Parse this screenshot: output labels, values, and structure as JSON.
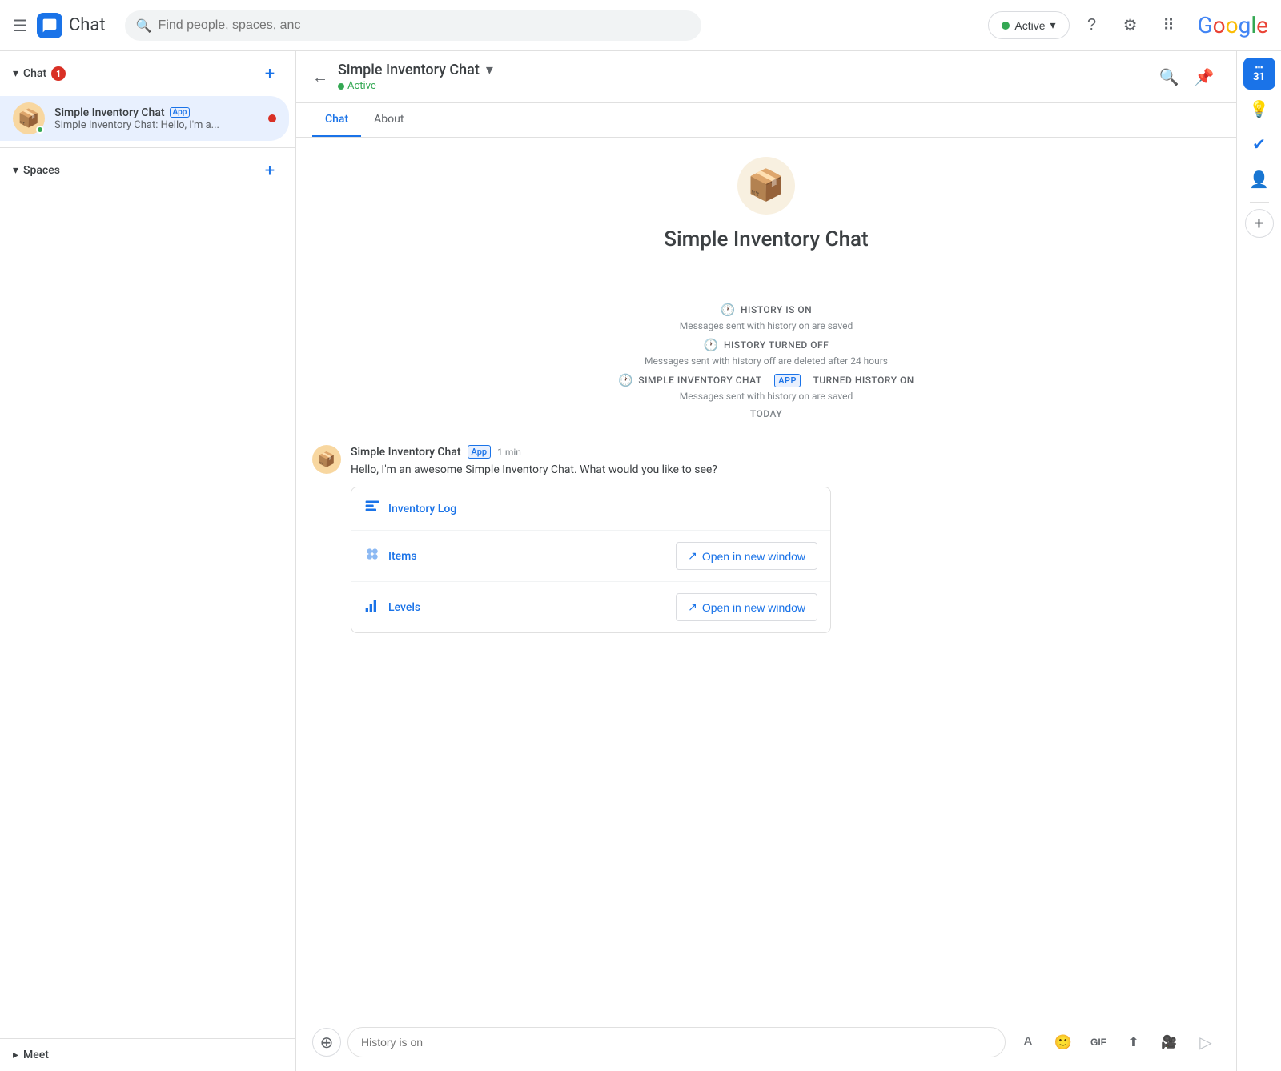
{
  "topbar": {
    "menu_label": "☰",
    "app_name": "Chat",
    "search_placeholder": "Find people, spaces, anc",
    "status_label": "Active",
    "google_label": "Google"
  },
  "sidebar": {
    "chat_section_label": "Chat",
    "chat_badge": "1",
    "add_chat_label": "+",
    "spaces_section_label": "Spaces",
    "add_spaces_label": "+",
    "meet_section_label": "Meet",
    "chat_item": {
      "name": "Simple Inventory Chat",
      "app_badge": "App",
      "preview": "Simple Inventory Chat: Hello, I'm a..."
    }
  },
  "chat_header": {
    "title": "Simple Inventory Chat",
    "status": "Active",
    "tab_chat": "Chat",
    "tab_about": "About"
  },
  "chat_area": {
    "bot_name": "Simple Inventory Chat",
    "history_on_label": "HISTORY IS ON",
    "history_on_sub": "Messages sent with history on are saved",
    "history_off_label": "HISTORY TURNED OFF",
    "history_off_sub": "Messages sent with history off are deleted after 24 hours",
    "history_on2_prefix": "SIMPLE INVENTORY CHAT",
    "history_on2_app": "APP",
    "history_on2_suffix": "TURNED HISTORY ON",
    "history_on2_sub": "Messages sent with history on are saved",
    "today_label": "TODAY",
    "message": {
      "sender": "Simple Inventory Chat",
      "app_badge": "App",
      "time": "1 min",
      "text": "Hello, I'm an awesome  Simple Inventory Chat. What would you like to see?"
    },
    "card": {
      "rows": [
        {
          "icon": "📊",
          "label": "Inventory Log",
          "has_button": false
        },
        {
          "icon": "📦",
          "label": "Items",
          "has_button": true,
          "button_label": "Open in new window"
        },
        {
          "icon": "📈",
          "label": "Levels",
          "has_button": true,
          "button_label": "Open in new window"
        }
      ]
    },
    "input_placeholder": "History is on"
  },
  "right_sidebar": {
    "items": [
      {
        "name": "calendar-icon",
        "symbol": "31",
        "colored": true,
        "badge": ""
      },
      {
        "name": "keep-icon",
        "symbol": "💡",
        "colored": false,
        "badge": ""
      },
      {
        "name": "tasks-icon",
        "symbol": "✓",
        "colored": false,
        "badge": ""
      },
      {
        "name": "contacts-icon",
        "symbol": "👤",
        "colored": false,
        "badge": ""
      }
    ],
    "add_label": "+"
  }
}
